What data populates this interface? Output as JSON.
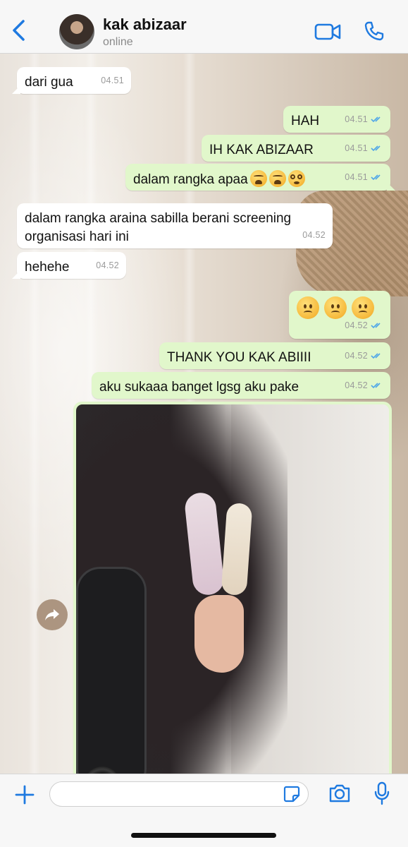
{
  "header": {
    "contact_name": "kak abizaar",
    "status": "online",
    "icons": [
      "back-chevron-icon",
      "video-call-icon",
      "phone-call-icon"
    ]
  },
  "messages": [
    {
      "direction": "in",
      "text": "dari gua",
      "time": "04.51"
    },
    {
      "direction": "out",
      "text": "HAH",
      "time": "04.51",
      "read": true
    },
    {
      "direction": "out",
      "text": "IH KAK ABIZAAR",
      "time": "04.51",
      "read": true
    },
    {
      "direction": "out",
      "text": "dalam rangka apaa",
      "emojis": [
        "weary-face",
        "weary-face",
        "dizzy-face"
      ],
      "time": "04.51",
      "read": true
    },
    {
      "direction": "in",
      "text_line1": "dalam rangka araina sabilla berani screening",
      "text_line2": "organisasi hari ini",
      "time": "04.52"
    },
    {
      "direction": "in",
      "text": "hehehe",
      "time": "04.52"
    },
    {
      "direction": "out",
      "emojis": [
        "slightly-frowning-face",
        "slightly-frowning-face",
        "slightly-frowning-face"
      ],
      "time": "04.52",
      "read": true
    },
    {
      "direction": "out",
      "text": "THANK YOU KAK ABIIII",
      "time": "04.52",
      "read": true
    },
    {
      "direction": "out",
      "text": "aku sukaaa banget lgsg aku pake",
      "time": "04.52",
      "read": true
    },
    {
      "direction": "out",
      "type": "photo",
      "description_icon": "photo-message"
    }
  ],
  "colors": {
    "accent": "#1f7ae0",
    "incoming_bubble": "#ffffff",
    "outgoing_bubble": "#e1f7cb",
    "read_ticks": "#4fa6e8",
    "timestamp": "#9a9a9a"
  },
  "input_bar": {
    "value": "",
    "placeholder": "",
    "icons": [
      "plus-icon",
      "sticker-icon",
      "camera-icon",
      "microphone-icon"
    ]
  }
}
